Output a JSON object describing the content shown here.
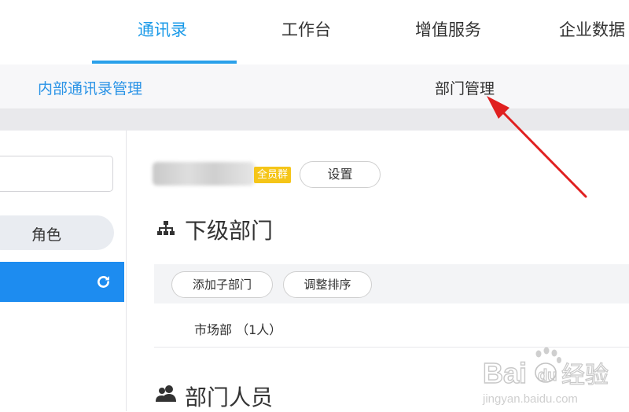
{
  "top_nav": {
    "tabs": [
      {
        "label": "通讯录",
        "active": true
      },
      {
        "label": "工作台",
        "active": false
      },
      {
        "label": "增值服务",
        "active": false
      },
      {
        "label": "企业数据",
        "active": false
      }
    ]
  },
  "sub_nav": {
    "items": [
      {
        "label": "内部通讯录管理"
      },
      {
        "label": "部门管理"
      }
    ]
  },
  "sidebar": {
    "search_value": "",
    "role_label": "角色",
    "selected_item_icon": "refresh-icon"
  },
  "org": {
    "name_badge": "全员群",
    "settings_label": "设置"
  },
  "sub_departments": {
    "title": "下级部门",
    "icon": "org-tree-icon",
    "add_label": "添加子部门",
    "sort_label": "调整排序",
    "rows": [
      {
        "label": "市场部 （1人）"
      }
    ]
  },
  "members": {
    "title": "部门人员",
    "icon": "people-icon"
  },
  "watermark": {
    "brand": "Bai du 经验",
    "url": "jingyan.baidu.com"
  },
  "colors": {
    "accent": "#1a9ae8",
    "selected_row": "#1d8cf0",
    "badge": "#f5c518",
    "arrow": "#e02020"
  }
}
